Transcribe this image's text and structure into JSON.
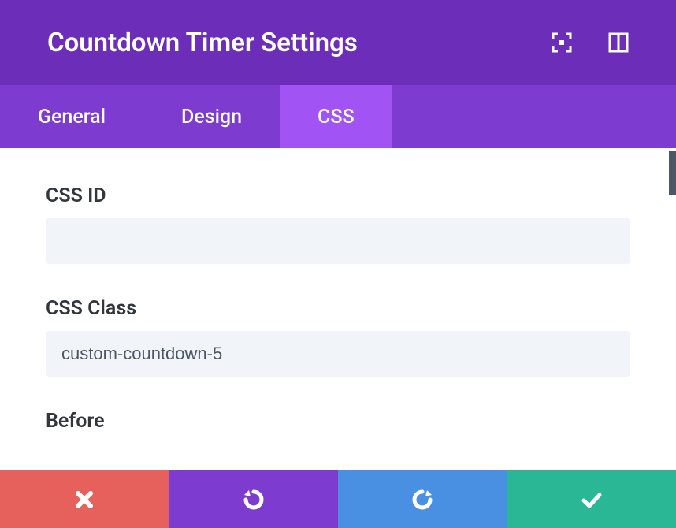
{
  "header": {
    "title": "Countdown Timer Settings"
  },
  "tabs": [
    {
      "label": "General",
      "active": false
    },
    {
      "label": "Design",
      "active": false
    },
    {
      "label": "CSS",
      "active": true
    }
  ],
  "fields": {
    "css_id": {
      "label": "CSS ID",
      "value": ""
    },
    "css_class": {
      "label": "CSS Class",
      "value": "custom-countdown-5"
    },
    "before": {
      "label": "Before"
    }
  },
  "colors": {
    "header": "#6c2eb9",
    "tabs": "#7e3bd0",
    "tab_active": "#a153f4",
    "cancel": "#e6605c",
    "undo": "#7e3bd0",
    "redo": "#4a90e2",
    "save": "#2ab796"
  }
}
